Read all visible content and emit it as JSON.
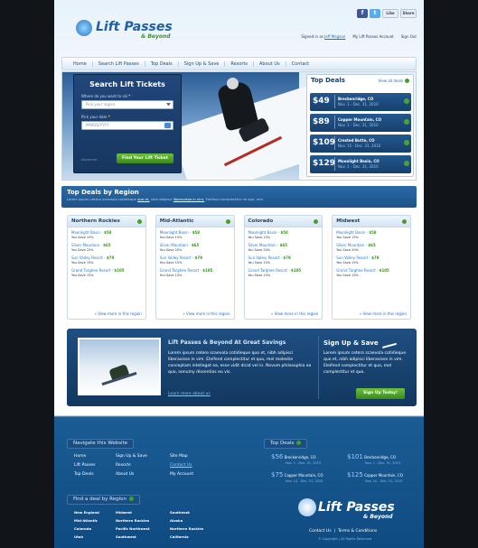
{
  "header": {
    "logo_text": "Lift Passes",
    "logo_sub": "& Beyond",
    "social": {
      "like": "Like",
      "share": "Share"
    },
    "signed_in_prefix": "Signed in as",
    "user_name": "Jeff Mogson",
    "account_link": "My Lift Passes Account",
    "signout": "Sign Out"
  },
  "nav": [
    "Home",
    "Search Lift Passes",
    "Top Deals",
    "Sign Up & Save",
    "Resorts",
    "About Us",
    "Contact"
  ],
  "search": {
    "title": "Search Lift Tickets",
    "q1": "Where do you want to ski",
    "q1_placeholder": "Pick your region",
    "q2": "Pick your date",
    "q2_placeholder": "MM/DD/YYYY",
    "small": "Advanced",
    "button": "Find Your Lift Ticket"
  },
  "top_deals": {
    "title": "Top Deals",
    "view_all": "View all deals",
    "items": [
      {
        "price": "$49",
        "name": "Breckenridge, CO",
        "date": "Nov. 1 - Dec. 31, 2010"
      },
      {
        "price": "$89",
        "name": "Copper Mountain, CO",
        "date": "Nov. 1 - Dec. 31, 2010"
      },
      {
        "price": "$109",
        "name": "Crested Butte, CO",
        "date": "Nov. 15 - Dec. 31, 2010"
      },
      {
        "price": "$129",
        "name": "Moonlight Basin, CO",
        "date": "Nov. 1 - Dec. 31, 2010"
      }
    ]
  },
  "regions": {
    "title": "Top Deals by Region",
    "subtitle_a": "Lorem ipsum cetero scaevola cotidieque",
    "subtitle_link1": "quo et,",
    "subtitle_b": "nibh adipisci",
    "subtitle_link2": "liberavisse in vim.",
    "subtitle_c": "Eleifend complectitur et quo, mel",
    "more": "» View more in this region",
    "columns": [
      {
        "name": "Northern Rockies",
        "items": [
          {
            "name": "Moonlight Basin",
            "price": "$58",
            "save": "You Save 15%"
          },
          {
            "name": "Silver Mountain",
            "price": "$65",
            "save": "You Save 20%"
          },
          {
            "name": "Sun Valley Resort",
            "price": "$79",
            "save": "You Save 15%"
          },
          {
            "name": "Grand Targhee Resort",
            "price": "$105",
            "save": "You Save 15%"
          }
        ]
      },
      {
        "name": "Mid-Atlantic",
        "items": [
          {
            "name": "Moonlight Basin",
            "price": "$58",
            "save": "You Save 15%"
          },
          {
            "name": "Silver Mountain",
            "price": "$65",
            "save": "You Save 20%"
          },
          {
            "name": "Sun Valley Resort",
            "price": "$79",
            "save": "You Save 15%"
          },
          {
            "name": "Grand Targhee Resort",
            "price": "$105",
            "save": "You Save 15%"
          }
        ]
      },
      {
        "name": "Colorado",
        "items": [
          {
            "name": "Moonlight Basin",
            "price": "$58",
            "save": "You Save 15%"
          },
          {
            "name": "Silver Mountain",
            "price": "$65",
            "save": "You Save 20%"
          },
          {
            "name": "Sun Valley Resort",
            "price": "$79",
            "save": "You Save 15%"
          },
          {
            "name": "Grand Targhee Resort",
            "price": "$105",
            "save": "You Save 15%"
          }
        ]
      },
      {
        "name": "Midwest",
        "items": [
          {
            "name": "Moonlight Basin",
            "price": "$58",
            "save": "You Save 15%"
          },
          {
            "name": "Silver Mountain",
            "price": "$65",
            "save": "You Save 20%"
          },
          {
            "name": "Sun Valley Resort",
            "price": "$79",
            "save": "You Save 15%"
          },
          {
            "name": "Grand Targhee Resort",
            "price": "$105",
            "save": "You Save 15%"
          }
        ]
      }
    ]
  },
  "promo": {
    "title": "Lift Passes & Beyond At Great Savings",
    "text": "Lorem ipsum cetero scaevola cotidieque quo et, nibh adipisci liberavisse in vim. Eleifend complectitur et quo, mel molestie conceptam intellegat ea, esse vidit dicat vel in. Novum philosophia ea quo, nonumy dissentias eu vis.",
    "more": "Learn more about us",
    "signup_title": "Sign Up & Save",
    "signup_text": "Lorem ipsum cetero scaevola cotidieque quo et, nibh adipisci liberavisse in vim. Eleifend complectitur et quo, mel complectitur et quo.",
    "signup_button": "Sign Up Today!"
  },
  "footer": {
    "navigate_title": "Navigate this Website",
    "links_col1": [
      "Home",
      "Lift Passes",
      "Top Deals"
    ],
    "links_col2": [
      "Sign Up & Save",
      "Resorts",
      "About Us"
    ],
    "links_col3": [
      "Site Map",
      "Contact Us",
      "My Account"
    ],
    "deals_title": "Top Deals",
    "deals": [
      {
        "price": "$56",
        "name": "Breckenridge, CO",
        "date": "Nov. 1 - Dec. 31, 2010"
      },
      {
        "price": "$101",
        "name": "Breckenridge, CO",
        "date": "Nov. 1 - Dec. 31, 2010"
      },
      {
        "price": "$75",
        "name": "Copper Mountain, CO",
        "date": "Nov. 14 - Dec. 31, 2010"
      },
      {
        "price": "$125",
        "name": "Copper Mountain, CO",
        "date": "Nov. 10 - Dec. 31, 2010"
      }
    ],
    "find_title": "Find a deal by Region",
    "regions_col1": [
      "New England",
      "Mid-Atlantic",
      "Colorado",
      "Utah"
    ],
    "regions_col2": [
      "Midwest",
      "Northern Rockies",
      "Pacific Northwest",
      "Southwest"
    ],
    "regions_col3": [
      "Southeast",
      "Alaska",
      "Northern Rockies",
      "California"
    ],
    "logo_text": "Lift Passes",
    "logo_sub": "& Beyond",
    "contact": "Contact Us",
    "terms": "Terms & Conditions",
    "copyright": "© Copyright | All Rights Reserved"
  }
}
